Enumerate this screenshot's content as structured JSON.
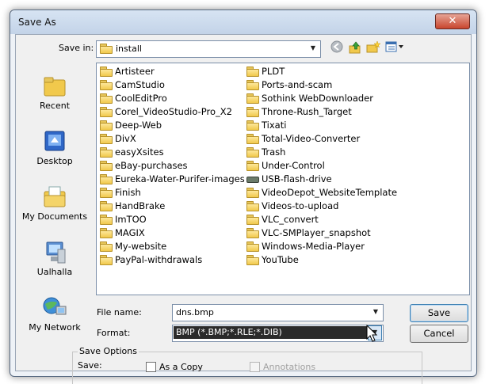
{
  "window": {
    "title": "Save As",
    "close_glyph": "✕"
  },
  "save_in": {
    "label": "Save in:",
    "value": "install",
    "icon": "folder-icon"
  },
  "toolbar": {
    "back_icon": "back-icon",
    "up_icon": "up-folder-icon",
    "new_folder_icon": "new-folder-icon",
    "views_icon": "views-menu-icon"
  },
  "places": [
    {
      "label": "Recent",
      "icon": "recent-folder-icon"
    },
    {
      "label": "Desktop",
      "icon": "desktop-icon"
    },
    {
      "label": "My Documents",
      "icon": "my-documents-icon"
    },
    {
      "label": "Ualhalla",
      "icon": "computer-icon"
    },
    {
      "label": "My Network",
      "icon": "network-icon"
    }
  ],
  "files": {
    "column1": [
      "Artisteer",
      "CamStudio",
      "CoolEditPro",
      "Corel_VideoStudio-Pro_X2",
      "Deep-Web",
      "DivX",
      "easyXsites",
      "eBay-purchases",
      "Eureka-Water-Purifer-images",
      "Finish",
      "HandBrake",
      "ImTOO",
      "MAGIX",
      "My-website",
      "PayPal-withdrawals"
    ],
    "column2": [
      "PLDT",
      "Ports-and-scam",
      "Sothink WebDownloader",
      "Throne-Rush_Target",
      "Tixati",
      "Total-Video-Converter",
      "Trash",
      "Under-Control",
      "USB-flash-drive",
      "VideoDepot_WebsiteTemplate",
      "Videos-to-upload",
      "VLC_convert",
      "VLC-SMPlayer_snapshot",
      "Windows-Media-Player",
      "YouTube"
    ]
  },
  "file_name": {
    "label": "File name:",
    "value": "dns.bmp"
  },
  "format": {
    "label": "Format:",
    "value": "BMP (*.BMP;*.RLE;*.DIB)"
  },
  "buttons": {
    "save": "Save",
    "cancel": "Cancel"
  },
  "save_options": {
    "legend": "Save Options",
    "save_label": "Save:",
    "as_copy": "As a Copy",
    "annotations": "Annotations"
  }
}
